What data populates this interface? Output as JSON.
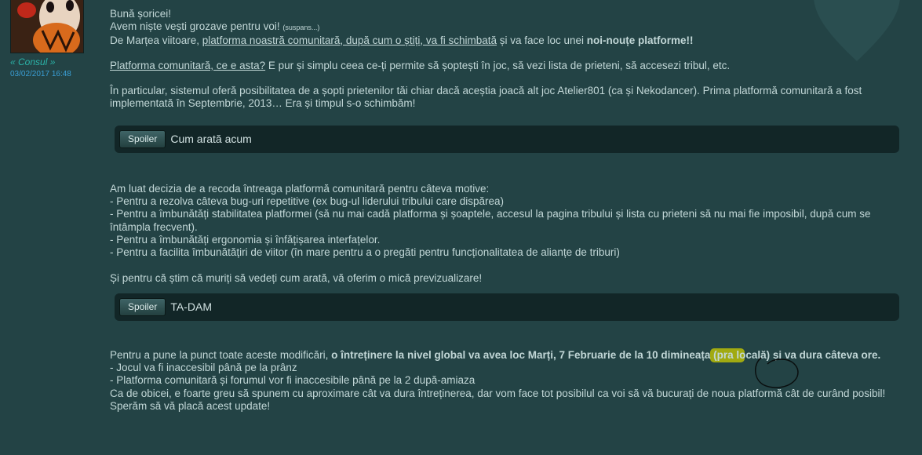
{
  "author": {
    "rank": "« Consul »",
    "date": "03/02/2017 16:48"
  },
  "post": {
    "greeting": "Bună șoricei!",
    "line2": "Avem niște vești grozave pentru voi!",
    "line2_small": "(suspans...)",
    "line3_a": "De Marțea viitoare, ",
    "line3_link": "platforma noastră comunitară, după cum o știți, va fi schimbată",
    "line3_b": " și va face loc unei ",
    "line3_bold": "noi-nouțe platforme!!",
    "p2_link": "Platforma comunitară, ce e asta?",
    "p2_text": " E pur și simplu ceea ce-ți permite să șoptești în joc, să vezi lista de prieteni, să accesezi tribul, etc.",
    "p3": "În particular, sistemul oferă posibilitatea de a șopti prietenilor tăi chiar dacă aceștia joacă alt joc Atelier801 (ca și Nekodancer). Prima platformă comunitară a fost implementată în Septembrie, 2013… Era și timpul s-o schimbăm!",
    "spoiler1": {
      "button": "Spoiler",
      "title": "Cum arată acum"
    },
    "p4_intro": "Am luat decizia de a recoda întreaga platformă comunitară pentru câteva motive:",
    "p4_items": [
      "- Pentru a rezolva câteva bug-uri repetitive (ex bug-ul liderului tribului care dispărea)",
      "- Pentru a îmbunătăți stabilitatea platformei (să nu mai cadă platforma și șoaptele, accesul la pagina tribului și lista cu prieteni să nu mai fie imposibil, după cum se întâmpla frecvent).",
      "- Pentru a îmbunătăți ergonomia și înfățișarea interfațelor.",
      "- Pentru a facilita îmbunătățiri de viitor (în mare pentru a o pregăti pentru funcționalitatea de alianțe de triburi)"
    ],
    "p5": "Și pentru că știm că muriți să vedeți cum arată, vă oferim o mică previzualizare!",
    "spoiler2": {
      "button": "Spoiler",
      "title": "TA-DAM"
    },
    "p6_a": "Pentru a pune la punct toate aceste modificări, ",
    "p6_bold1": "o întreținere la nivel global va avea loc Marți, 7 Februarie de la 10 dimineața ",
    "p6_hl": "(pra",
    "p6_bold2": " locală) și va dura câteva ore.",
    "p6_items": [
      "- Jocul va fi inaccesibil până pe la prânz",
      "- Platforma comunitară și forumul vor fi inaccesibile până pe la 2 după-amiaza"
    ],
    "p7": "Ca de obicei, e foarte greu să spunem cu aproximare cât va dura întreținerea, dar vom face tot posibilul ca voi să vă bucurați de noua platformă cât de curând posibil!",
    "p8": "Sperăm să vă placă acest update!"
  },
  "colors": {
    "background": "#234345",
    "spoiler_bg": "#122627",
    "rank": "#2bb3a8",
    "date": "#3a9fd6",
    "highlight": "#cccc00"
  }
}
